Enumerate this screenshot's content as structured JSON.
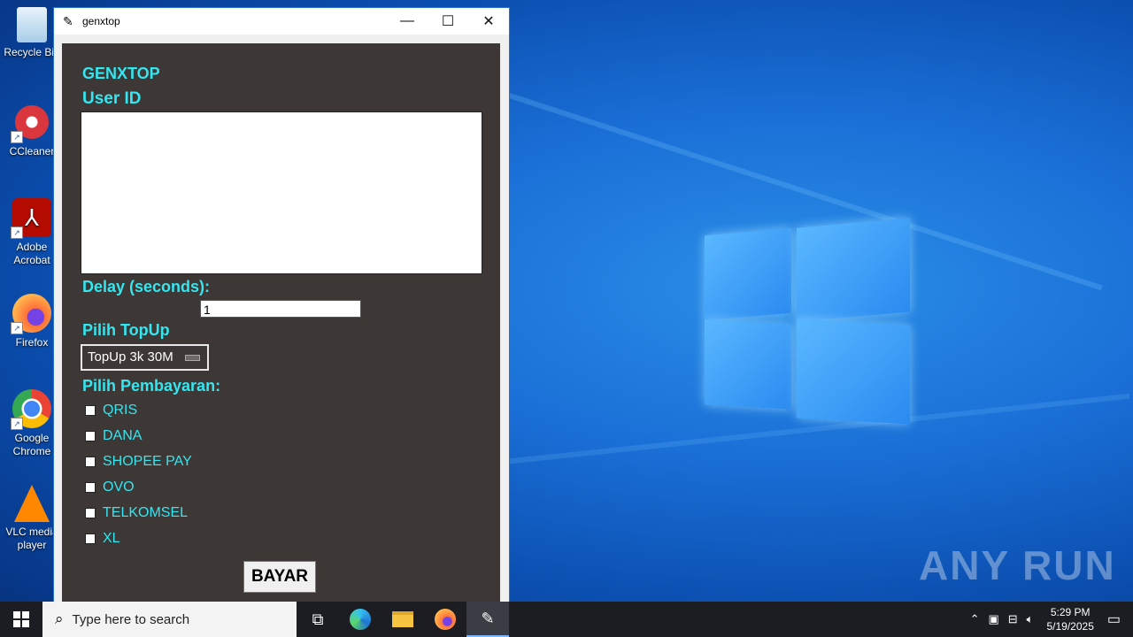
{
  "desktop": {
    "icons": [
      {
        "label": "Recycle Bin",
        "icon": "recycle-bin-icon",
        "color": "#cfe6f7"
      },
      {
        "label": "CCleaner",
        "icon": "ccleaner-icon",
        "color": "#d9363e"
      },
      {
        "label": "Adobe Acrobat",
        "icon": "acrobat-icon",
        "color": "#b30b00"
      },
      {
        "label": "Firefox",
        "icon": "firefox-icon",
        "color": "#ff7139"
      },
      {
        "label": "Google Chrome",
        "icon": "chrome-icon",
        "color": "#4285f4"
      },
      {
        "label": "VLC media player",
        "icon": "vlc-icon",
        "color": "#ff8800"
      }
    ],
    "watermark": "ANY RUN"
  },
  "window": {
    "title": "genxtop",
    "minimize": "—",
    "maximize": "☐",
    "close": "✕"
  },
  "form": {
    "app_title": "GENXTOP",
    "user_id_label": "User ID",
    "user_id_value": "",
    "delay_label": "Delay (seconds):",
    "delay_value": "1",
    "topup_label": "Pilih TopUp",
    "topup_selected": "TopUp 3k 30M",
    "payment_label": "Pilih Pembayaran:",
    "payments": [
      "QRIS",
      "DANA",
      "SHOPEE PAY",
      "OVO",
      "TELKOMSEL",
      "XL"
    ],
    "submit_label": "BAYAR"
  },
  "taskbar": {
    "search_placeholder": "Type here to search",
    "time": "5:29 PM",
    "date": "5/19/2025"
  }
}
